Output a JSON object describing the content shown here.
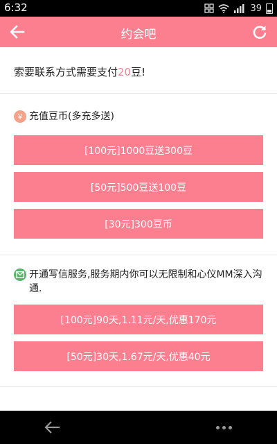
{
  "status_bar": {
    "time": "6:32",
    "battery": "39"
  },
  "app_bar": {
    "title": "约会吧",
    "back_icon": "arrow-left-icon",
    "refresh_icon": "refresh-icon"
  },
  "notice": {
    "prefix": "索要联系方式需要支付",
    "amount": "20",
    "suffix": "豆!"
  },
  "recharge": {
    "icon": "yen-coin-icon",
    "badge_symbol": "¥",
    "title": "充值豆币(多充多送)",
    "options": [
      "[100元]1000豆送300豆",
      "[50元]500豆送100豆",
      "[30元]300豆币"
    ]
  },
  "messaging": {
    "icon": "mail-icon",
    "title": "开通写信服务,服务期内你可以无限制和心仪MM深入沟通.",
    "options": [
      "[100元]90天,1.11元/天,优惠170元",
      "[50元]30天,1.67元/天,优惠40元"
    ]
  },
  "colors": {
    "accent": "#fc7f8f",
    "coin_badge": "#f6a18a",
    "mail_badge": "#59b66a"
  }
}
